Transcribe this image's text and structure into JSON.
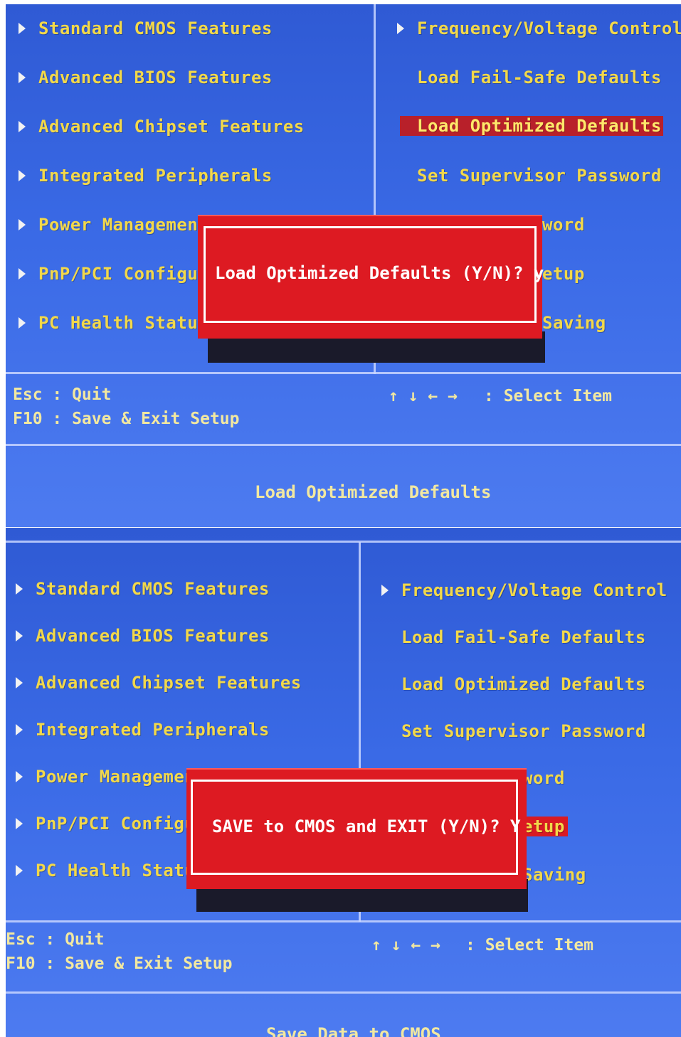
{
  "screen1": {
    "left_menu": [
      "Standard CMOS Features",
      "Advanced BIOS Features",
      "Advanced Chipset Features",
      "Integrated Peripherals",
      "Power Management",
      "PnP/PCI Configura",
      "PC Health Status"
    ],
    "right_menu": [
      "Frequency/Voltage Control",
      "Load Fail-Safe Defaults",
      "Load Optimized Defaults",
      "Set Supervisor Password",
      "word",
      "etup",
      "Saving"
    ],
    "dialog_text": "Load Optimized Defaults (Y/N)? y",
    "help_left": [
      "Esc : Quit",
      "F10 : Save & Exit Setup"
    ],
    "help_arrows": "↑ ↓ ← →",
    "help_right": ": Select Item",
    "status": "Load Optimized Defaults"
  },
  "screen2": {
    "left_menu": [
      "Standard CMOS Features",
      "Advanced BIOS Features",
      "Advanced Chipset Features",
      "Integrated Peripherals",
      "Power Management",
      "PnP/PCI Configura",
      "PC Health Status"
    ],
    "right_menu": [
      "Frequency/Voltage Control",
      "Load Fail-Safe Defaults",
      "Load Optimized Defaults",
      "Set Supervisor Password",
      "word",
      "etup",
      "Saving"
    ],
    "dialog_text": "SAVE to CMOS and EXIT (Y/N)? Y",
    "help_left": [
      "Esc : Quit",
      "F10 : Save & Exit Setup"
    ],
    "help_arrows": "↑ ↓ ← →",
    "help_right": ": Select Item",
    "status": "Save Data to CMOS"
  },
  "colors": {
    "background": "#3a6ae6",
    "menu_text": "#f2d84a",
    "dialog": "#dd1a22",
    "highlight": "#b8202a"
  }
}
